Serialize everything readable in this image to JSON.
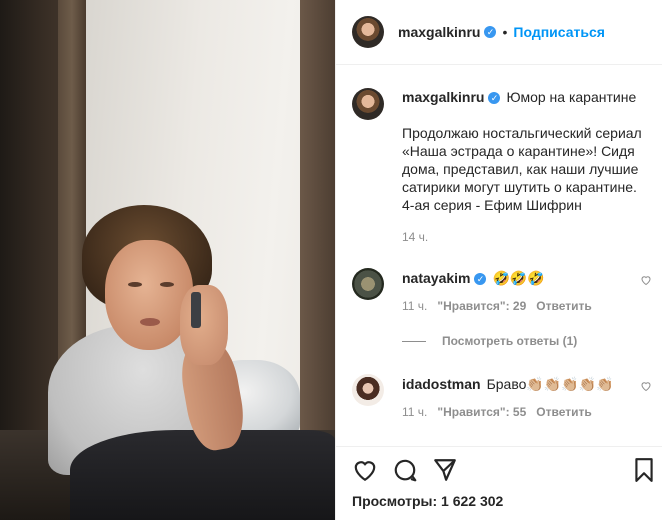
{
  "header": {
    "username": "maxgalkinru",
    "verified_mark": "✓",
    "separator": "•",
    "follow_label": "Подписаться"
  },
  "caption": {
    "username": "maxgalkinru",
    "title": "Юмор на карантине",
    "text": "Продолжаю ностальгический сериал «Наша эстрада о карантине»! Сидя дома, представил, как наши лучшие сатирики могут шутить о карантине.\n4-ая серия - Ефим Шифрин",
    "time": "14 ч."
  },
  "comments": [
    {
      "username": "natayakim",
      "text": "🤣🤣🤣",
      "time": "11 ч.",
      "likes": "\"Нравится\": 29",
      "reply_label": "Ответить"
    },
    {
      "username": "idadostman",
      "text": "Браво👏🏼👏🏼👏🏼👏🏼👏🏼",
      "time": "11 ч.",
      "likes": "\"Нравится\": 55",
      "reply_label": "Ответить"
    }
  ],
  "view_replies": "Посмотреть ответы (1)",
  "views": "Просмотры: 1 622 302",
  "icons": {
    "like": "heart-icon",
    "comment": "comment-icon",
    "share": "share-icon",
    "save": "bookmark-icon"
  },
  "colors": {
    "accent": "#0095f6",
    "verified": "#3897f0",
    "secondary_text": "#8e8e8e"
  }
}
